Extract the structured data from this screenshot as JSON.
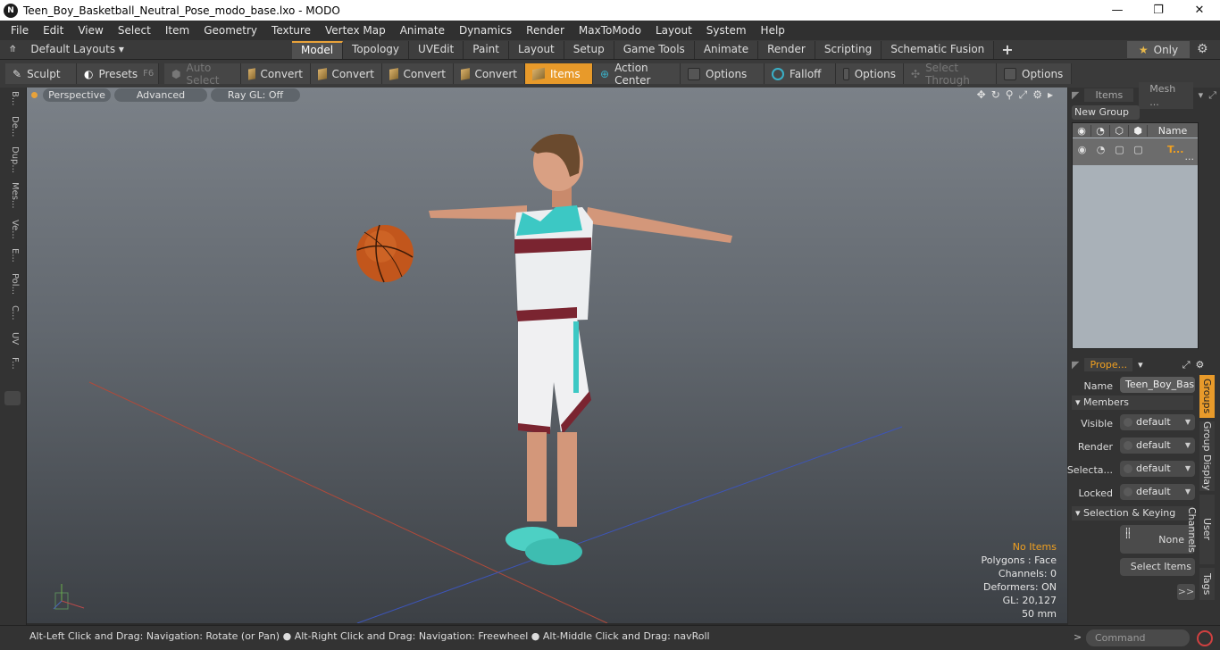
{
  "window": {
    "title": "Teen_Boy_Basketball_Neutral_Pose_modo_base.lxo - MODO",
    "minimize": "—",
    "maximize": "❐",
    "close": "✕"
  },
  "menu": [
    "File",
    "Edit",
    "View",
    "Select",
    "Item",
    "Geometry",
    "Texture",
    "Vertex Map",
    "Animate",
    "Dynamics",
    "Render",
    "MaxToModo",
    "Layout",
    "System",
    "Help"
  ],
  "layouts": {
    "label": "Default Layouts ▾",
    "tabs": [
      "Model",
      "Topology",
      "UVEdit",
      "Paint",
      "Layout",
      "Setup",
      "Game Tools",
      "Animate",
      "Render",
      "Scripting",
      "Schematic Fusion"
    ],
    "active_tab": "Model",
    "add": "+",
    "only_label": "Only"
  },
  "toolbar": {
    "sculpt": "Sculpt",
    "presets": "Presets",
    "presets_key": "F6",
    "auto_select": "Auto Select",
    "convert1": "Convert",
    "convert2": "Convert",
    "convert3": "Convert",
    "convert4": "Convert",
    "items": "Items",
    "action_center": "Action Center",
    "options1": "Options",
    "falloff": "Falloff",
    "options2": "Options",
    "select_through": "Select Through",
    "options3": "Options"
  },
  "left_strip": [
    "B...",
    "De...",
    "Dup...",
    "Mes...",
    "Ve...",
    "E...",
    "Pol...",
    "C...",
    "UV",
    "F..."
  ],
  "viewport": {
    "perspective": "Perspective",
    "advanced": "Advanced",
    "raygl": "Ray GL: Off",
    "hud": {
      "no_items": "No Items",
      "polygons": "Polygons : Face",
      "channels": "Channels: 0",
      "deformers": "Deformers: ON",
      "gl": "GL: 20,127",
      "focal": "50 mm"
    }
  },
  "groups_panel": {
    "tab_items": "Items",
    "tab_mesh": "Mesh ...",
    "new_group": "New Group",
    "col_name": "Name",
    "row_name": "T...",
    "row_more": "..."
  },
  "properties": {
    "tab": "Prope...",
    "name_label": "Name",
    "name_value": "Teen_Boy_Bask",
    "members": "Members",
    "visible_label": "Visible",
    "visible_value": "default",
    "render_label": "Render",
    "render_value": "default",
    "selectable_label": "Selecta...",
    "selectable_value": "default",
    "locked_label": "Locked",
    "locked_value": "default",
    "selection_keying": "Selection & Keying",
    "none_label": "None",
    "select_items": "Select Items",
    "expand": ">>"
  },
  "side_tabs": [
    "Groups",
    "Group Display",
    "User Channels",
    "Tags"
  ],
  "status": {
    "text": "Alt-Left Click and Drag: Navigation: Rotate (or Pan) ● Alt-Right Click and Drag: Navigation: Freewheel ● Alt-Middle Click and Drag: navRoll",
    "command_placeholder": "Command"
  },
  "colors": {
    "accent": "#e89a2a",
    "highlight_text": "#f0a020"
  }
}
